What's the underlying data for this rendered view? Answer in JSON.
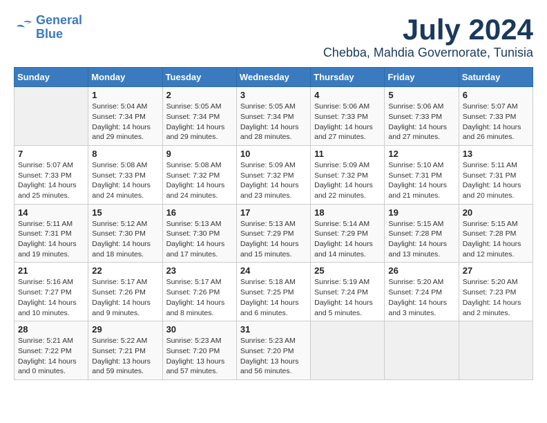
{
  "header": {
    "logo_line1": "General",
    "logo_line2": "Blue",
    "month": "July 2024",
    "location": "Chebba, Mahdia Governorate, Tunisia"
  },
  "weekdays": [
    "Sunday",
    "Monday",
    "Tuesday",
    "Wednesday",
    "Thursday",
    "Friday",
    "Saturday"
  ],
  "weeks": [
    [
      {
        "day": "",
        "info": ""
      },
      {
        "day": "1",
        "info": "Sunrise: 5:04 AM\nSunset: 7:34 PM\nDaylight: 14 hours\nand 29 minutes."
      },
      {
        "day": "2",
        "info": "Sunrise: 5:05 AM\nSunset: 7:34 PM\nDaylight: 14 hours\nand 29 minutes."
      },
      {
        "day": "3",
        "info": "Sunrise: 5:05 AM\nSunset: 7:34 PM\nDaylight: 14 hours\nand 28 minutes."
      },
      {
        "day": "4",
        "info": "Sunrise: 5:06 AM\nSunset: 7:33 PM\nDaylight: 14 hours\nand 27 minutes."
      },
      {
        "day": "5",
        "info": "Sunrise: 5:06 AM\nSunset: 7:33 PM\nDaylight: 14 hours\nand 27 minutes."
      },
      {
        "day": "6",
        "info": "Sunrise: 5:07 AM\nSunset: 7:33 PM\nDaylight: 14 hours\nand 26 minutes."
      }
    ],
    [
      {
        "day": "7",
        "info": "Sunrise: 5:07 AM\nSunset: 7:33 PM\nDaylight: 14 hours\nand 25 minutes."
      },
      {
        "day": "8",
        "info": "Sunrise: 5:08 AM\nSunset: 7:33 PM\nDaylight: 14 hours\nand 24 minutes."
      },
      {
        "day": "9",
        "info": "Sunrise: 5:08 AM\nSunset: 7:32 PM\nDaylight: 14 hours\nand 24 minutes."
      },
      {
        "day": "10",
        "info": "Sunrise: 5:09 AM\nSunset: 7:32 PM\nDaylight: 14 hours\nand 23 minutes."
      },
      {
        "day": "11",
        "info": "Sunrise: 5:09 AM\nSunset: 7:32 PM\nDaylight: 14 hours\nand 22 minutes."
      },
      {
        "day": "12",
        "info": "Sunrise: 5:10 AM\nSunset: 7:31 PM\nDaylight: 14 hours\nand 21 minutes."
      },
      {
        "day": "13",
        "info": "Sunrise: 5:11 AM\nSunset: 7:31 PM\nDaylight: 14 hours\nand 20 minutes."
      }
    ],
    [
      {
        "day": "14",
        "info": "Sunrise: 5:11 AM\nSunset: 7:31 PM\nDaylight: 14 hours\nand 19 minutes."
      },
      {
        "day": "15",
        "info": "Sunrise: 5:12 AM\nSunset: 7:30 PM\nDaylight: 14 hours\nand 18 minutes."
      },
      {
        "day": "16",
        "info": "Sunrise: 5:13 AM\nSunset: 7:30 PM\nDaylight: 14 hours\nand 17 minutes."
      },
      {
        "day": "17",
        "info": "Sunrise: 5:13 AM\nSunset: 7:29 PM\nDaylight: 14 hours\nand 15 minutes."
      },
      {
        "day": "18",
        "info": "Sunrise: 5:14 AM\nSunset: 7:29 PM\nDaylight: 14 hours\nand 14 minutes."
      },
      {
        "day": "19",
        "info": "Sunrise: 5:15 AM\nSunset: 7:28 PM\nDaylight: 14 hours\nand 13 minutes."
      },
      {
        "day": "20",
        "info": "Sunrise: 5:15 AM\nSunset: 7:28 PM\nDaylight: 14 hours\nand 12 minutes."
      }
    ],
    [
      {
        "day": "21",
        "info": "Sunrise: 5:16 AM\nSunset: 7:27 PM\nDaylight: 14 hours\nand 10 minutes."
      },
      {
        "day": "22",
        "info": "Sunrise: 5:17 AM\nSunset: 7:26 PM\nDaylight: 14 hours\nand 9 minutes."
      },
      {
        "day": "23",
        "info": "Sunrise: 5:17 AM\nSunset: 7:26 PM\nDaylight: 14 hours\nand 8 minutes."
      },
      {
        "day": "24",
        "info": "Sunrise: 5:18 AM\nSunset: 7:25 PM\nDaylight: 14 hours\nand 6 minutes."
      },
      {
        "day": "25",
        "info": "Sunrise: 5:19 AM\nSunset: 7:24 PM\nDaylight: 14 hours\nand 5 minutes."
      },
      {
        "day": "26",
        "info": "Sunrise: 5:20 AM\nSunset: 7:24 PM\nDaylight: 14 hours\nand 3 minutes."
      },
      {
        "day": "27",
        "info": "Sunrise: 5:20 AM\nSunset: 7:23 PM\nDaylight: 14 hours\nand 2 minutes."
      }
    ],
    [
      {
        "day": "28",
        "info": "Sunrise: 5:21 AM\nSunset: 7:22 PM\nDaylight: 14 hours\nand 0 minutes."
      },
      {
        "day": "29",
        "info": "Sunrise: 5:22 AM\nSunset: 7:21 PM\nDaylight: 13 hours\nand 59 minutes."
      },
      {
        "day": "30",
        "info": "Sunrise: 5:23 AM\nSunset: 7:20 PM\nDaylight: 13 hours\nand 57 minutes."
      },
      {
        "day": "31",
        "info": "Sunrise: 5:23 AM\nSunset: 7:20 PM\nDaylight: 13 hours\nand 56 minutes."
      },
      {
        "day": "",
        "info": ""
      },
      {
        "day": "",
        "info": ""
      },
      {
        "day": "",
        "info": ""
      }
    ]
  ]
}
